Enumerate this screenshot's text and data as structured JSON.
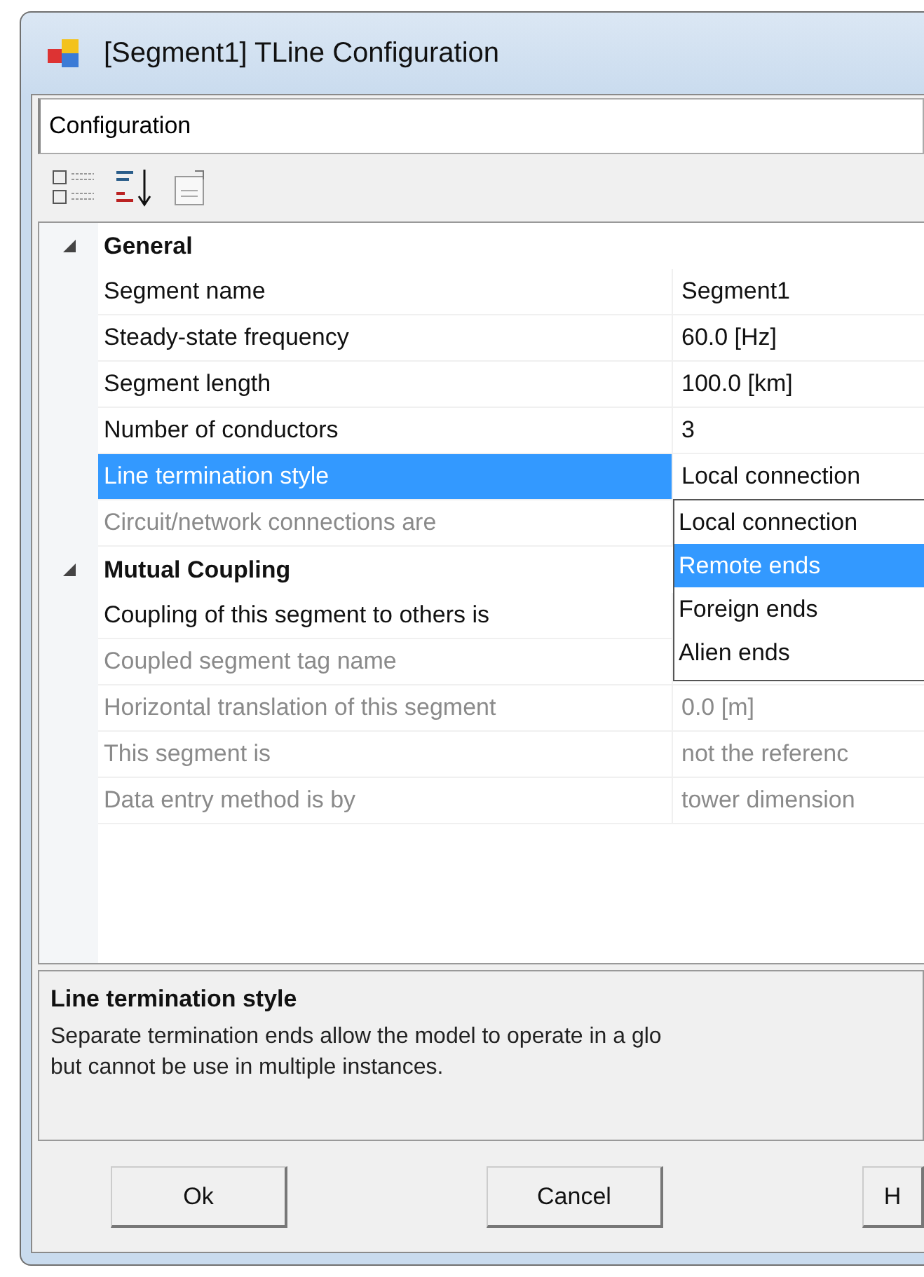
{
  "window": {
    "title": "[Segment1] TLine Configuration"
  },
  "category_field": {
    "value": "Configuration"
  },
  "grid": {
    "categories": [
      {
        "name": "General",
        "expanded": true,
        "properties": [
          {
            "label": "Segment name",
            "value": "Segment1",
            "disabled": false,
            "selected": false
          },
          {
            "label": "Steady-state frequency",
            "value": "60.0 [Hz]",
            "disabled": false,
            "selected": false
          },
          {
            "label": "Segment length",
            "value": "100.0 [km]",
            "disabled": false,
            "selected": false
          },
          {
            "label": "Number of conductors",
            "value": "3",
            "disabled": false,
            "selected": false
          },
          {
            "label": "Line termination style",
            "value": "Local connection",
            "disabled": false,
            "selected": true,
            "dropdown": {
              "options": [
                {
                  "label": "Local connection",
                  "selected": false
                },
                {
                  "label": "Remote ends",
                  "selected": true
                },
                {
                  "label": "Foreign ends",
                  "selected": false
                },
                {
                  "label": "Alien ends",
                  "selected": false
                }
              ]
            }
          },
          {
            "label": "Circuit/network connections are",
            "disabled": true,
            "selected": false
          }
        ]
      },
      {
        "name": "Mutual Coupling",
        "expanded": true,
        "properties": [
          {
            "label": "Coupling of this segment to others is",
            "disabled": false,
            "selected": false
          },
          {
            "label": "Coupled segment tag name",
            "disabled": true,
            "selected": false
          },
          {
            "label": "Horizontal translation of this segment",
            "value": "0.0 [m]",
            "disabled": true,
            "selected": false
          },
          {
            "label": "This segment is",
            "value": "not the referenc",
            "disabled": true,
            "selected": false
          },
          {
            "label": "Data entry method is by",
            "value": "tower dimension",
            "disabled": true,
            "selected": false
          }
        ]
      }
    ]
  },
  "description": {
    "title": "Line termination style",
    "text": "Separate termination ends allow the model to operate in a glo\nbut cannot be use in multiple instances."
  },
  "buttons": [
    "Ok",
    "Cancel",
    "H"
  ]
}
